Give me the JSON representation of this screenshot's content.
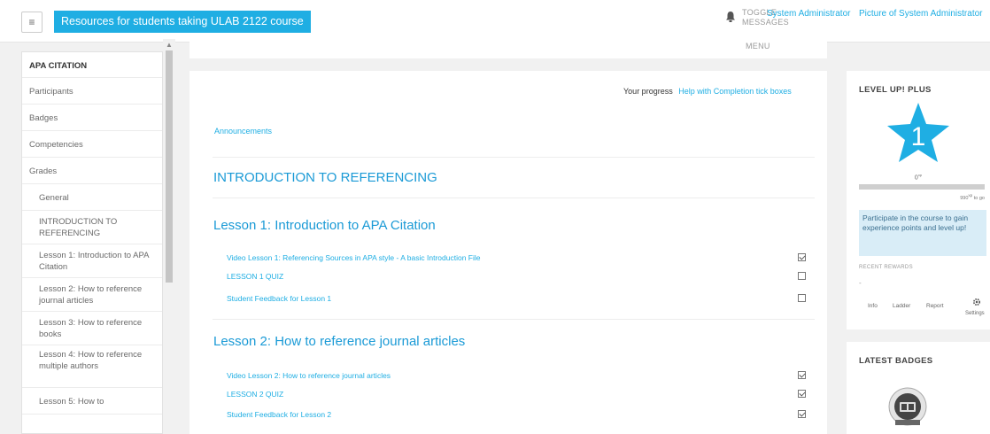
{
  "navbar": {
    "menu_icon": "hamburger-icon",
    "course_title": "Resources for students taking ULAB 2122 course",
    "toggle_label": "TOGGLE",
    "messages_label": "MESSAGES",
    "menu_label": "MENU",
    "user_name": "System Administrator",
    "user_picture": "Picture of System Administrator"
  },
  "drawer": {
    "items": [
      "APA CITATION",
      "Participants",
      "Badges",
      "Competencies",
      "Grades",
      "General",
      "INTRODUCTION TO REFERENCING",
      "Lesson 1: Introduction to APA Citation",
      "Lesson 2: How to reference journal articles",
      "Lesson 3: How to reference books",
      "Lesson 4: How to reference multiple authors",
      "Lesson 5: How to"
    ]
  },
  "main": {
    "progress_label": "Your progress",
    "progress_help": "Help with Completion tick boxes",
    "announcements": "Announcements",
    "intro_heading": "INTRODUCTION TO REFERENCING",
    "lessons": [
      {
        "title": "Lesson 1: Introduction to APA Citation",
        "activities": [
          {
            "label": "Video Lesson 1: Referencing Sources in APA style - A basic Introduction File",
            "done": true
          },
          {
            "label": "LESSON 1 QUIZ",
            "done": false
          },
          {
            "label": "Student Feedback for Lesson 1",
            "done": false
          }
        ]
      },
      {
        "title": "Lesson 2: How to reference journal articles",
        "activities": [
          {
            "label": "Video Lesson 2: How to reference journal articles",
            "done": true
          },
          {
            "label": "LESSON 2 QUIZ",
            "done": true
          },
          {
            "label": "Student Feedback for Lesson 2",
            "done": true
          }
        ]
      }
    ]
  },
  "levelup": {
    "title": "LEVEL UP! PLUS",
    "level": "1",
    "xp": "0",
    "xp_progress": 0.0,
    "xp_next": "990",
    "info_text": "Participate in the course to gain experience points and level up!",
    "recent_rewards": "RECENT REWARDS",
    "recent_value": "-",
    "nav": [
      "Info",
      "Ladder",
      "Report",
      "Settings"
    ]
  },
  "badges_block": {
    "title": "LATEST BADGES"
  },
  "colors": {
    "accent": "#1faee3",
    "star": "#1faee3",
    "info_bg": "#d9edf7"
  }
}
